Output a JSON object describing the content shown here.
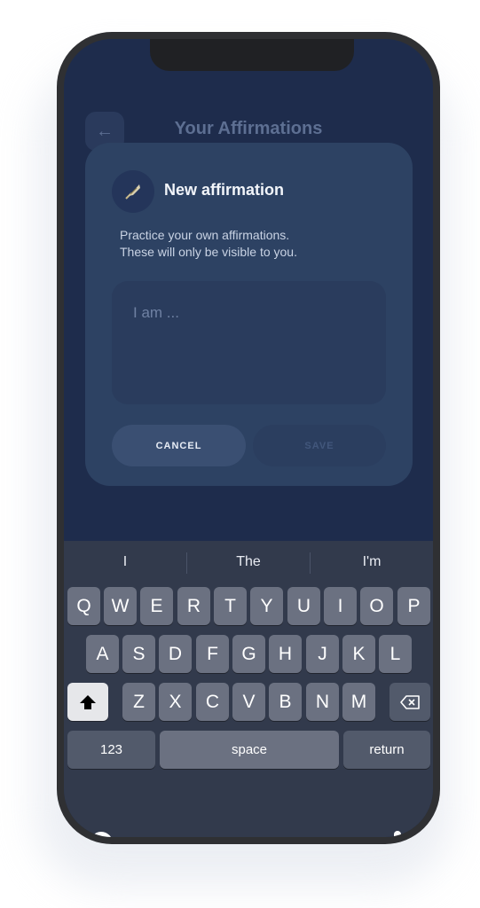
{
  "app": {
    "title": "Your Affirmations",
    "back_icon": "arrow-left-icon"
  },
  "dialog": {
    "icon": "quill-pen-icon",
    "title": "New affirmation",
    "description_line1": "Practice your own affirmations.",
    "description_line2": "These will only be visible to you.",
    "input_placeholder": "I am ...",
    "input_value": "",
    "cancel_label": "CANCEL",
    "save_label": "SAVE"
  },
  "keyboard": {
    "suggestions": [
      "I",
      "The",
      "I'm"
    ],
    "row1": [
      "Q",
      "W",
      "E",
      "R",
      "T",
      "Y",
      "U",
      "I",
      "O",
      "P"
    ],
    "row2": [
      "A",
      "S",
      "D",
      "F",
      "G",
      "H",
      "J",
      "K",
      "L"
    ],
    "row3": [
      "Z",
      "X",
      "C",
      "V",
      "B",
      "N",
      "M"
    ],
    "numbers_label": "123",
    "space_label": "space",
    "return_label": "return",
    "shift_icon": "shift-icon",
    "backspace_icon": "backspace-icon",
    "emoji_icon": "emoji-icon",
    "dictation_icon": "microphone-icon"
  },
  "colors": {
    "screen_bg": "#1e2c4c",
    "dialog_bg": "#2d4263",
    "keyboard_bg": "#323a4c",
    "key_bg": "#6b7181"
  }
}
